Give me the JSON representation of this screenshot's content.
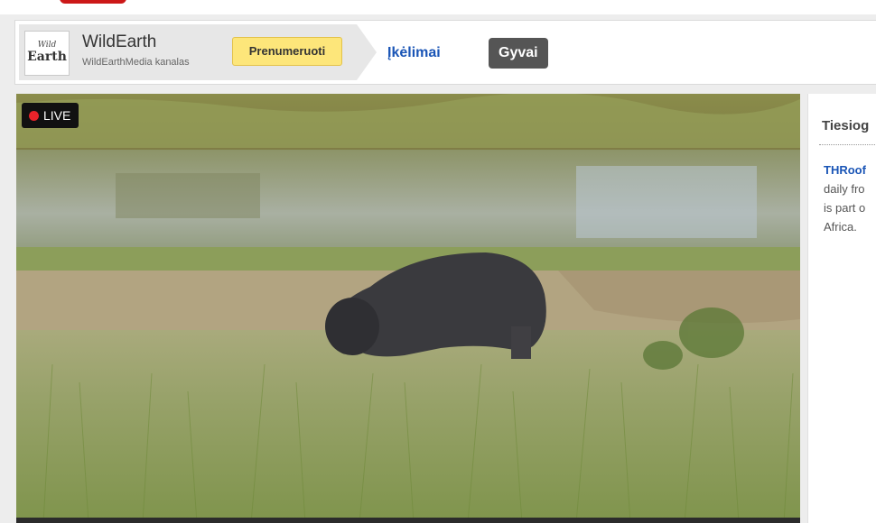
{
  "channel": {
    "logo_small": "Wild",
    "logo_big": "Earth",
    "name": "WildEarth",
    "subtitle": "WildEarthMedia kanalas",
    "subscribe_label": "Prenumeruoti"
  },
  "nav": {
    "uploads_label": "Įkėlimai",
    "live_label": "Gyvai"
  },
  "player": {
    "live_label": "LIVE"
  },
  "side_panel": {
    "title": "Tiesiog",
    "link": "THRoof",
    "line1": "daily fro",
    "line2": "is part o",
    "line3": "Africa."
  },
  "colors": {
    "subscribe_bg": "#fde67a",
    "link_blue": "#1a55b6",
    "live_red": "#e8232a"
  }
}
